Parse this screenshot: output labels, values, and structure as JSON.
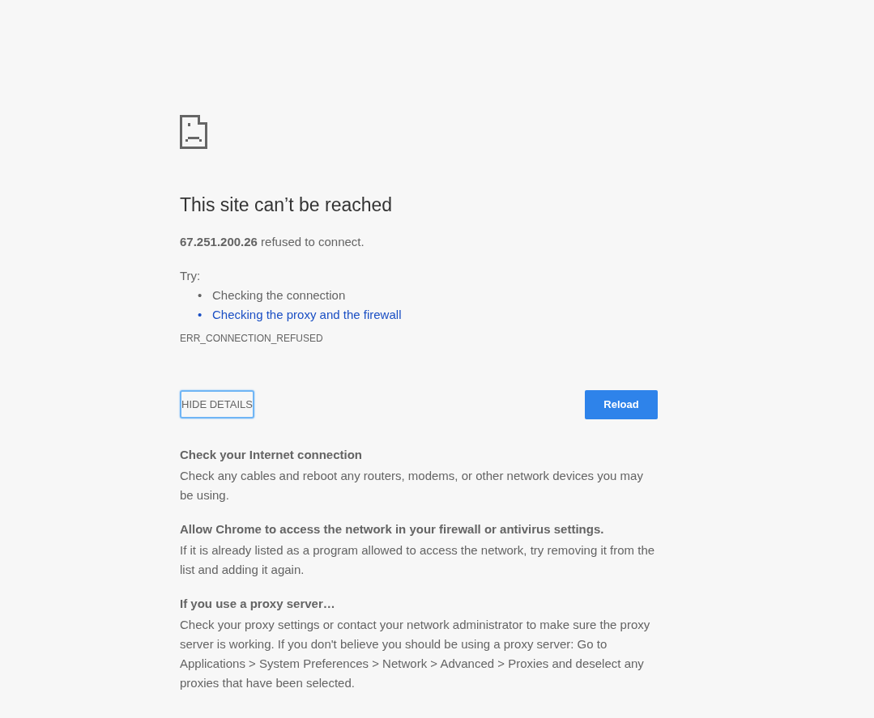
{
  "error": {
    "title": "This site can’t be reached",
    "message": "**67.251.200.26** refused to connect.",
    "try_label": "Try:",
    "suggestions": [
      {
        "kind": "text",
        "bullet": "•",
        "label": "Checking the connection"
      },
      {
        "kind": "link",
        "bullet": "•",
        "label": "Checking the proxy and the firewall"
      }
    ],
    "code": "ERR_CONNECTION_REFUSED"
  },
  "buttons": {
    "details": {
      "label": "HIDE DETAILS",
      "focused": true
    },
    "reload": {
      "label": "Reload"
    }
  },
  "details": [
    {
      "heading": "Check your Internet connection",
      "body": "Check any cables and reboot any routers, modems, or other network devices you may be using."
    },
    {
      "heading": "Allow Chrome to access the network in your firewall or antivirus settings.",
      "body": "If it is already listed as a program allowed to access the network, try removing it from the list and adding it again."
    },
    {
      "heading": "If you use a proxy server…",
      "body": "Check your proxy settings or contact your network administrator to make sure the proxy server is working. If you don't believe you should be using a proxy server: Go to Applications > System Preferences > Network > Advanced > Proxies and deselect any proxies that have been selected."
    }
  ]
}
